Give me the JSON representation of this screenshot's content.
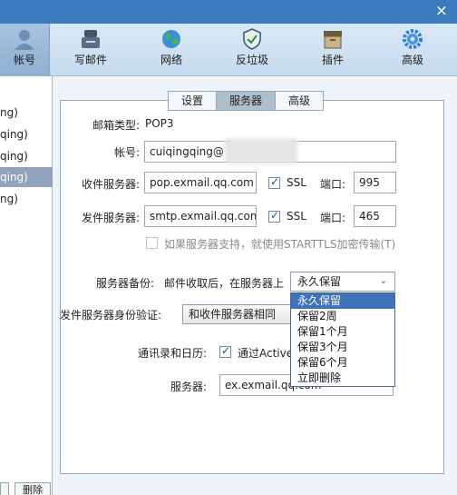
{
  "window": {
    "close": "×"
  },
  "toolbar": {
    "items": [
      {
        "label": "帐号",
        "icon": "user-icon"
      },
      {
        "label": "写邮件",
        "icon": "compose-icon"
      },
      {
        "label": "网络",
        "icon": "globe-icon"
      },
      {
        "label": "反垃圾",
        "icon": "shield-icon"
      },
      {
        "label": "插件",
        "icon": "plugin-icon"
      },
      {
        "label": "高级",
        "icon": "gear-icon"
      }
    ]
  },
  "accounts": [
    "ng)",
    "qing)",
    "qing)",
    "qing)",
    "ng)"
  ],
  "bottom_buttons": {
    "delete": "删除"
  },
  "tabs": [
    "设置",
    "服务器",
    "高级"
  ],
  "form": {
    "mailbox_type_label": "邮箱类型:",
    "mailbox_type_value": "POP3",
    "account_label": "帐号:",
    "account_value": "cuiqingqing@",
    "incoming_label": "收件服务器:",
    "incoming_value": "pop.exmail.qq.com",
    "outgoing_label": "发件服务器:",
    "outgoing_value": "smtp.exmail.qq.com",
    "ssl_label": "SSL",
    "port_label": "端口:",
    "incoming_port": "995",
    "outgoing_port": "465",
    "starttls_label": "如果服务器支持，就使用STARTTLS加密传输(T)",
    "backup_label": "服务器备份:",
    "backup_desc": "邮件收取后，在服务器上",
    "backup_selected": "永久保留",
    "auth_label": "发件服务器身份验证:",
    "auth_value": "和收件服务器相同",
    "contacts_label": "通讯录和日历:",
    "contacts_check_label": "通过Active",
    "server_label": "服务器:",
    "server_value": "ex.exmail.qq.com"
  },
  "dropdown_options": [
    "永久保留",
    "保留2周",
    "保留1个月",
    "保留3个月",
    "保留6个月",
    "立即删除"
  ]
}
